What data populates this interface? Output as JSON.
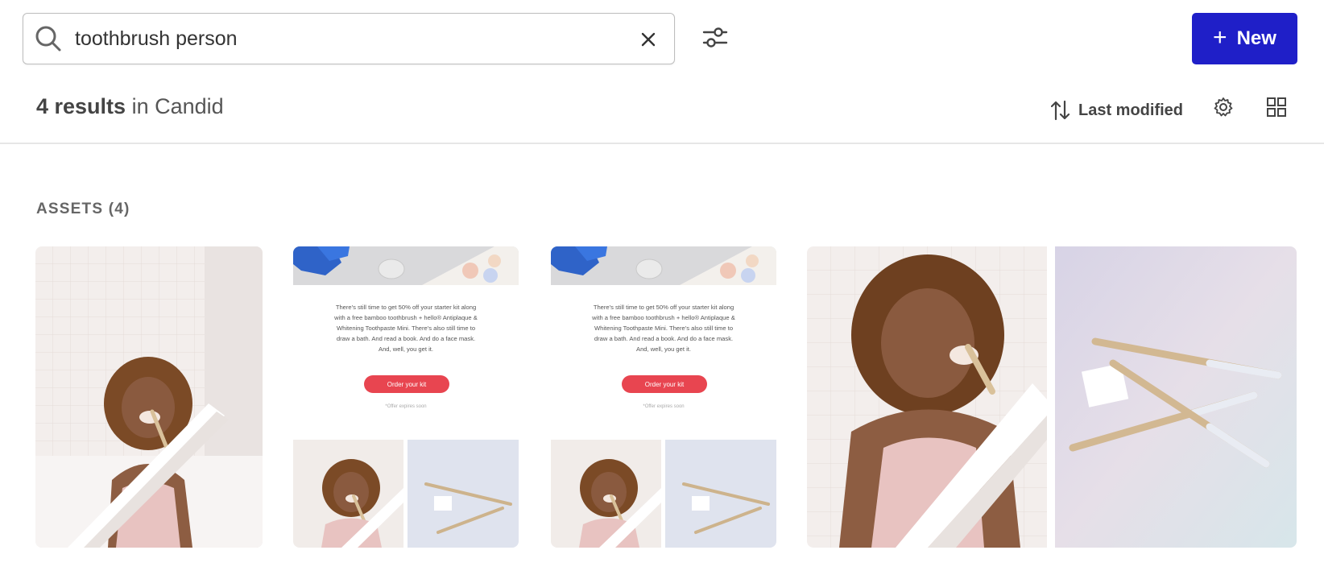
{
  "search": {
    "value": "toothbrush person",
    "placeholder": "Search"
  },
  "toolbar": {
    "new_label": "New",
    "new_icon": "plus-icon",
    "accent_color": "#1f1fc8"
  },
  "results": {
    "count_label": "4 results",
    "scope_label": "in Candid",
    "sort_label": "Last modified"
  },
  "sections": {
    "assets_title": "ASSETS (4)"
  },
  "assets": [
    {
      "kind": "photo",
      "subject": "person brushing teeth in mirror"
    },
    {
      "kind": "email",
      "body_line1": "There's still time to get 50% off your starter kit along",
      "body_line2": "with a free bamboo toothbrush + hello® Antiplaque &",
      "body_line3": "Whitening Toothpaste Mini. There's also still time to",
      "body_line4": "draw a bath. And read a book. And do a face mask.",
      "body_line5": "And, well, you get it.",
      "cta_label": "Order your kit",
      "footnote": "*Offer expires soon"
    },
    {
      "kind": "email",
      "body_line1": "There's still time to get 50% off your starter kit along",
      "body_line2": "with a free bamboo toothbrush + hello® Antiplaque &",
      "body_line3": "Whitening Toothpaste Mini. There's also still time to",
      "body_line4": "draw a bath. And read a book. And do a face mask.",
      "body_line5": "And, well, you get it.",
      "cta_label": "Order your kit",
      "footnote": "*Offer expires soon"
    },
    {
      "kind": "photo-pair",
      "subject": "person brushing teeth and bamboo toothbrushes"
    }
  ],
  "colors": {
    "cta": "#e84550",
    "text_muted": "#555555"
  }
}
